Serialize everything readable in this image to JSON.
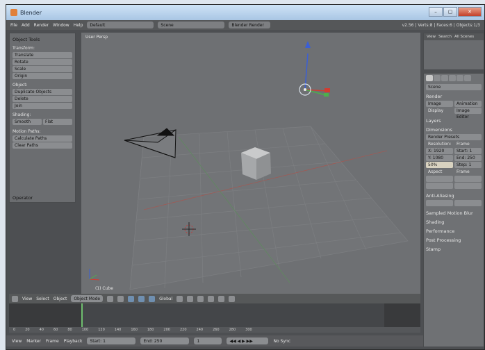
{
  "window": {
    "title": "Blender"
  },
  "topbar": {
    "menus": [
      "File",
      "Add",
      "Render",
      "Window",
      "Help"
    ],
    "layout": "Default",
    "scene": "Scene",
    "engine": "Blender Render",
    "stats": "v2.56 | Verts:8 | Faces:6 | Objects:1/3"
  },
  "shelf": {
    "header": "Object Tools",
    "transform_title": "Transform:",
    "transform_buttons": [
      "Translate",
      "Rotate",
      "Scale",
      "Origin"
    ],
    "object_title": "Object:",
    "object_buttons": [
      "Duplicate Objects",
      "Delete",
      "Join"
    ],
    "shading_title": "Shading:",
    "shading_buttons": [
      "Smooth",
      "Flat"
    ],
    "motion_title": "Motion Paths:",
    "motion_buttons": [
      "Calculate Paths",
      "Clear Paths"
    ],
    "operator": "Operator"
  },
  "viewport": {
    "label": "User Persp",
    "object": "(1) Cube"
  },
  "vp_header": {
    "menus": [
      "View",
      "Select",
      "Object"
    ],
    "mode": "Object Mode",
    "pivot": "Global"
  },
  "timeline": {
    "ruler": [
      "0",
      "20",
      "40",
      "60",
      "80",
      "100",
      "120",
      "140",
      "160",
      "180",
      "200",
      "220",
      "240",
      "260",
      "280",
      "300"
    ]
  },
  "bottombar": {
    "menus": [
      "View",
      "Marker",
      "Frame",
      "Playback"
    ],
    "start": "Start: 1",
    "end": "End: 250",
    "current": "1",
    "sync": "No Sync"
  },
  "outliner": {
    "tabs": [
      "View",
      "Search",
      "All Scenes"
    ]
  },
  "props": {
    "scene_name": "Scene",
    "render_title": "Render",
    "render_buttons": [
      "Image",
      "Animation"
    ],
    "display": "Display",
    "display_val": "Image Editor",
    "layers_title": "Layers",
    "dimensions_title": "Dimensions",
    "preset": "Render Presets",
    "resolution": "Resolution:",
    "frame_range": "Frame Range:",
    "res_x": "X: 1920",
    "res_y": "Y: 1080",
    "res_pct": "50%",
    "start": "Start: 1",
    "end": "End: 250",
    "step": "Step: 1",
    "aspect": "Aspect Ratio:",
    "frame_rate": "Frame Rate:",
    "aa_title": "Anti-Aliasing",
    "sampled_title": "Sampled Motion Blur",
    "shading_title": "Shading",
    "performance_title": "Performance",
    "post_title": "Post Processing",
    "stamp_title": "Stamp"
  },
  "colors": {
    "x_axis": "#d23c30",
    "y_axis": "#4cb04c",
    "z_axis": "#3b5fd6",
    "timeline_cursor": "#6fbf6f"
  }
}
